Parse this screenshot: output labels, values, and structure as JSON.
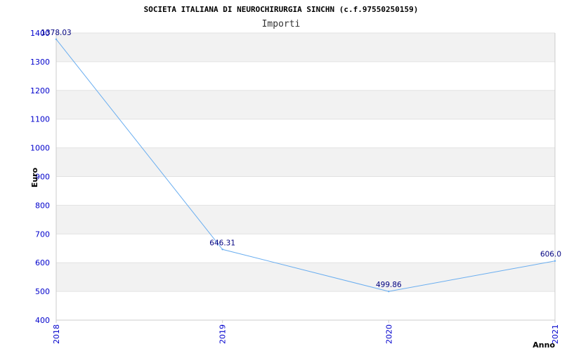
{
  "chart_data": {
    "type": "line",
    "title": "SOCIETA ITALIANA DI NEUROCHIRURGIA SINCHN (c.f.97550250159)",
    "subtitle": "Importi",
    "xlabel": "Anno",
    "ylabel": "Euro",
    "x": [
      "2018",
      "2019",
      "2020",
      "2021"
    ],
    "series": [
      {
        "values": [
          1378.03,
          646.31,
          499.86,
          606.0
        ]
      }
    ],
    "data_labels": [
      "1378.03",
      "646.31",
      "499.86",
      "606.0"
    ],
    "ylim": [
      400,
      1400
    ],
    "yticks": [
      400,
      500,
      600,
      700,
      800,
      900,
      1000,
      1100,
      1200,
      1300,
      1400
    ],
    "grid": true,
    "colors": {
      "line": "#6aaef0",
      "tick_text": "#0000cc",
      "label_text": "#000080",
      "band": "#f2f2f2",
      "grid": "#e2e2e2",
      "axis": "#cccccc"
    }
  }
}
